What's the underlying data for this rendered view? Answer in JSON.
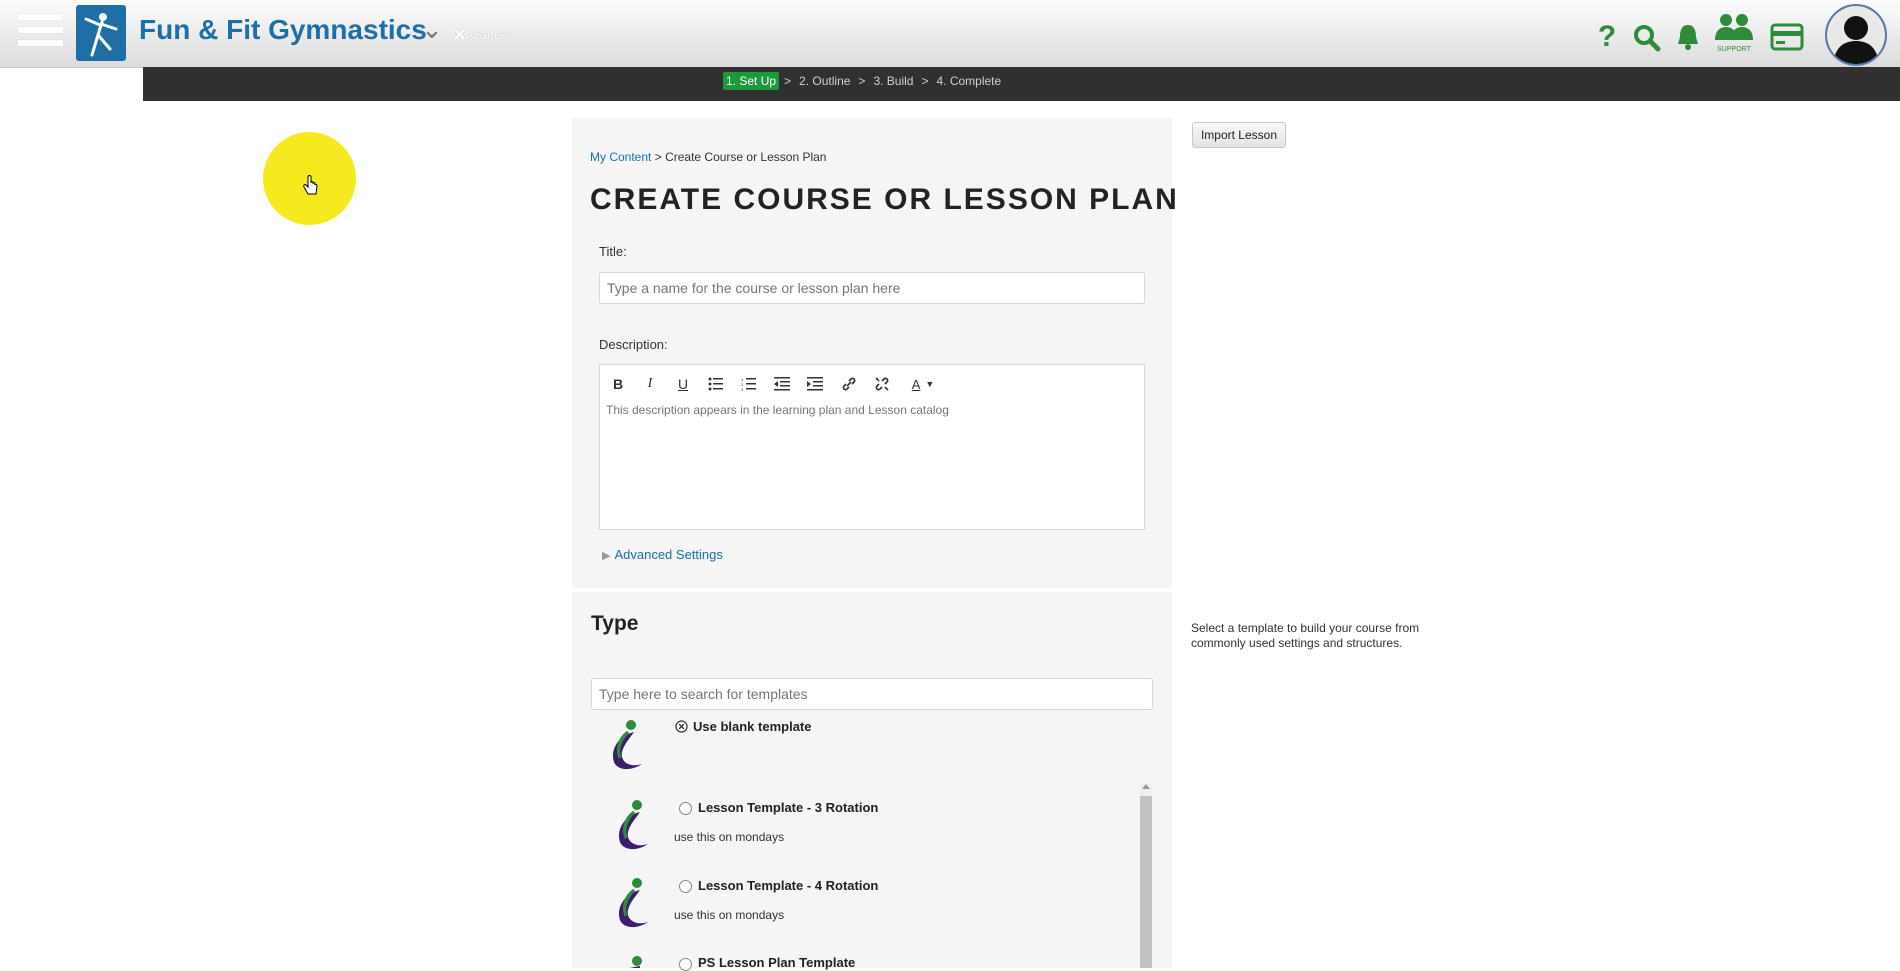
{
  "header": {
    "brand": "Fun & Fit Gymnastics",
    "cancel_label": "Cancel",
    "support_label": "SUPPORT",
    "icon_color": "#2e8b3a",
    "brand_color": "#1d6fa5"
  },
  "steps": [
    {
      "label": "1. Set Up",
      "active": true
    },
    {
      "label": "2. Outline",
      "active": false
    },
    {
      "label": "3. Build",
      "active": false
    },
    {
      "label": "4. Complete",
      "active": false
    }
  ],
  "step_separator": ">",
  "breadcrumb": {
    "link": "My Content",
    "separator": ">",
    "current": "Create Course or Lesson Plan"
  },
  "page_title": "CREATE COURSE OR LESSON PLAN",
  "form": {
    "title_label": "Title:",
    "title_value": "",
    "title_placeholder": "Type a name for the course or lesson plan here",
    "description_label": "Description:",
    "description_placeholder": "This description appears in the learning plan and Lesson catalog",
    "toolbar_icons": [
      "bold-icon",
      "italic-icon",
      "underline-icon",
      "bulleted-list-icon",
      "numbered-list-icon",
      "outdent-icon",
      "indent-icon",
      "link-icon",
      "unlink-icon",
      "text-color-icon"
    ],
    "advanced_settings": "Advanced Settings"
  },
  "type_section": {
    "heading": "Type",
    "search_placeholder": "Type here to search for templates",
    "blank_template": "Use blank template",
    "templates": [
      {
        "name": "Lesson Template - 3 Rotation",
        "description": "use this on mondays"
      },
      {
        "name": "Lesson Template - 4 Rotation",
        "description": "use this on mondays"
      },
      {
        "name": "PS Lesson Plan Template",
        "description": ""
      }
    ]
  },
  "sidebar": {
    "import_button": "Import Lesson",
    "template_help": "Select a template to build your course from commonly used settings and structures."
  }
}
